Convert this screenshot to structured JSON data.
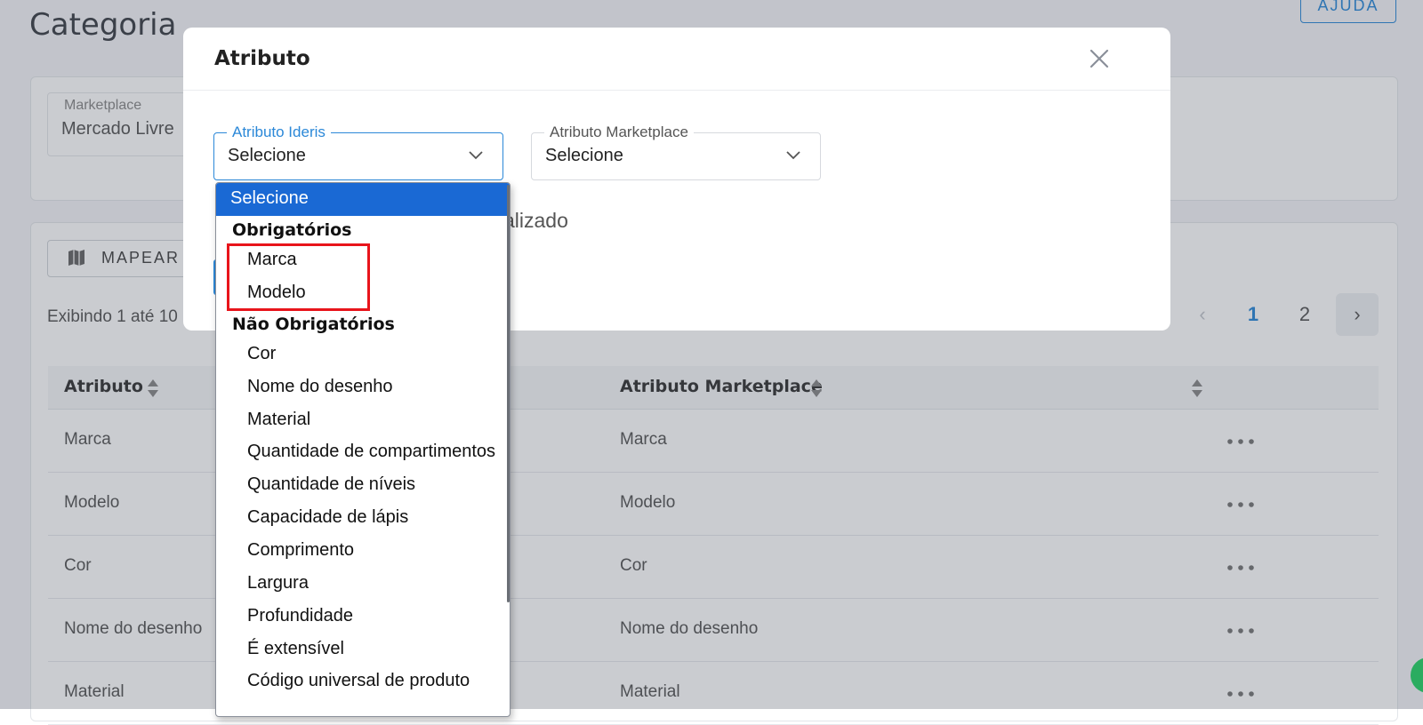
{
  "page": {
    "title": "Categoria",
    "help_label": "AJUDA",
    "marketplace_label": "Marketplace",
    "marketplace_value": "Mercado Livre",
    "map_button_label": "MAPEAR A",
    "showing_text": "Exibindo 1 até 10",
    "pagination": {
      "prev": "‹",
      "pages": [
        "1",
        "2"
      ],
      "current": "1",
      "next": "›"
    },
    "table": {
      "headers": [
        "Atributo",
        "Atributo Marketplace"
      ],
      "rows": [
        [
          "Marca",
          "Marca"
        ],
        [
          "Modelo",
          "Modelo"
        ],
        [
          "Cor",
          "Cor"
        ],
        [
          "Nome do desenho",
          "Nome do desenho"
        ],
        [
          "Material",
          "Material"
        ]
      ]
    }
  },
  "modal": {
    "title": "Atributo",
    "ideris_label": "Atributo Ideris",
    "ideris_value": "Selecione",
    "marketplace_label": "Atributo Marketplace",
    "marketplace_value": "Selecione",
    "behind_text": "alizado"
  },
  "dropdown": {
    "selected": "Selecione",
    "groups": [
      {
        "label": "Obrigatórios",
        "items": [
          "Marca",
          "Modelo"
        ]
      },
      {
        "label": "Não Obrigatórios",
        "items": [
          "Cor",
          "Nome do desenho",
          "Material",
          "Quantidade de compartimentos",
          "Quantidade de níveis",
          "Capacidade de lápis",
          "Comprimento",
          "Largura",
          "Profundidade",
          "É extensível",
          "Código universal de produto"
        ]
      }
    ]
  },
  "colors": {
    "accent": "#2b88d8",
    "dropdown_selected": "#1a69d4",
    "highlight": "#e8141b"
  }
}
